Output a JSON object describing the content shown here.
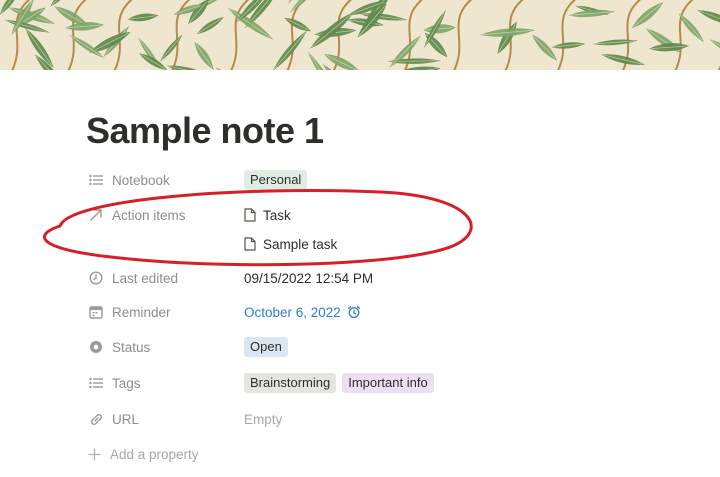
{
  "page": {
    "title": "Sample note 1"
  },
  "properties": [
    {
      "name": "Notebook",
      "icon": "list-icon",
      "type": "select",
      "value": "Personal",
      "color": "#dfece3"
    },
    {
      "name": "Action items",
      "icon": "arrow-up-right-icon",
      "type": "relation",
      "items": [
        "Task",
        "Sample task"
      ]
    },
    {
      "name": "Last edited",
      "icon": "clock-icon",
      "type": "text",
      "value": "09/15/2022 12:54 PM"
    },
    {
      "name": "Reminder",
      "icon": "calendar-icon",
      "type": "date",
      "value": "October 6, 2022",
      "color": "#2f80c8"
    },
    {
      "name": "Status",
      "icon": "status-icon",
      "type": "status",
      "value": "Open",
      "color": "#d9e7f2"
    },
    {
      "name": "Tags",
      "icon": "list-icon",
      "type": "multi_select",
      "values": [
        {
          "label": "Brainstorming",
          "color": "#e5e4e1"
        },
        {
          "label": "Important info",
          "color": "#ebe0f3"
        }
      ]
    },
    {
      "name": "URL",
      "icon": "link-icon",
      "type": "url",
      "value": "Empty"
    }
  ],
  "add_property": {
    "label": "Add a property",
    "icon": "plus-icon"
  },
  "annotation": {
    "shape": "ellipse",
    "color": "#d61f26",
    "target": "Action items"
  },
  "cover": {
    "pattern": "willow-leaves",
    "background": "#efe6cf",
    "leaf_color": "#7fa66a"
  }
}
